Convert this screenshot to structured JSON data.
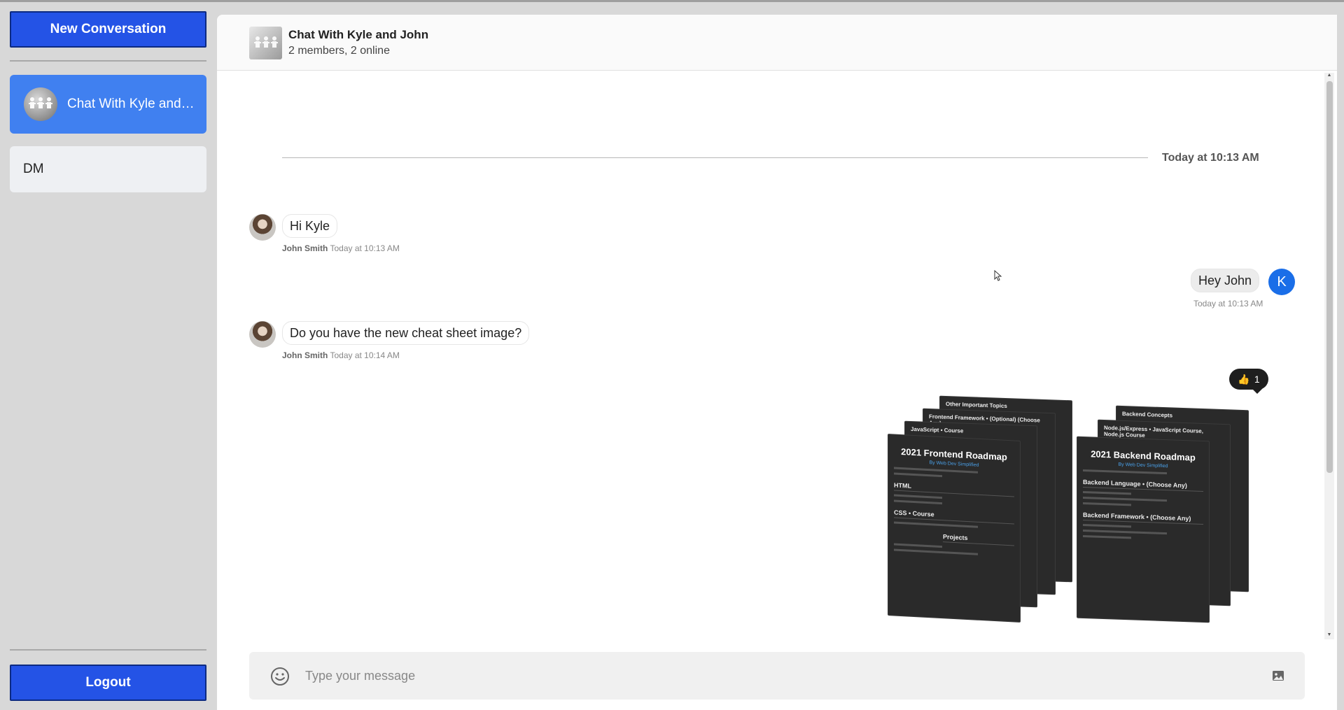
{
  "sidebar": {
    "new_conversation_label": "New Conversation",
    "logout_label": "Logout",
    "conversations": [
      {
        "name": "Chat With Kyle and John",
        "active": true
      },
      {
        "name": "DM",
        "active": false
      }
    ]
  },
  "header": {
    "title": "Chat With Kyle and John",
    "subtitle": "2 members, 2 online"
  },
  "messages": {
    "date_separator": "Today at 10:13 AM",
    "items": [
      {
        "author": "John Smith",
        "text": "Hi Kyle",
        "time": "Today at 10:13 AM",
        "own": false
      },
      {
        "author": "",
        "text": "Hey John",
        "time": "Today at 10:13 AM",
        "own": true,
        "avatar_letter": "K"
      },
      {
        "author": "John Smith",
        "text": "Do you have the new cheat sheet image?",
        "time": "Today at 10:14 AM",
        "own": false
      }
    ],
    "reaction": {
      "emoji": "👍",
      "count": "1"
    },
    "image_sheets": {
      "left": {
        "title": "2021 Frontend Roadmap",
        "byline": "By Web Dev Simplified",
        "back_tabs": [
          "Other Important Topics",
          "Frontend Framework • (Optional) (Choose Any)",
          "JavaScript • Course"
        ],
        "sections": [
          "HTML",
          "CSS • Course",
          "Projects"
        ]
      },
      "right": {
        "title": "2021 Backend Roadmap",
        "byline": "By Web Dev Simplified",
        "back_tabs": [
          "Backend Concepts",
          "Node.js/Express • JavaScript Course, Node.js Course"
        ],
        "sections": [
          "Backend Language • (Choose Any)",
          "Backend Framework • (Choose Any)"
        ]
      }
    }
  },
  "composer": {
    "placeholder": "Type your message"
  },
  "colors": {
    "primary_button": "#2453e6",
    "active_conversation": "#4080f0",
    "own_avatar": "#1a6ee8"
  },
  "icons": [
    "emoji-icon",
    "image-icon",
    "mouse-cursor-icon"
  ]
}
